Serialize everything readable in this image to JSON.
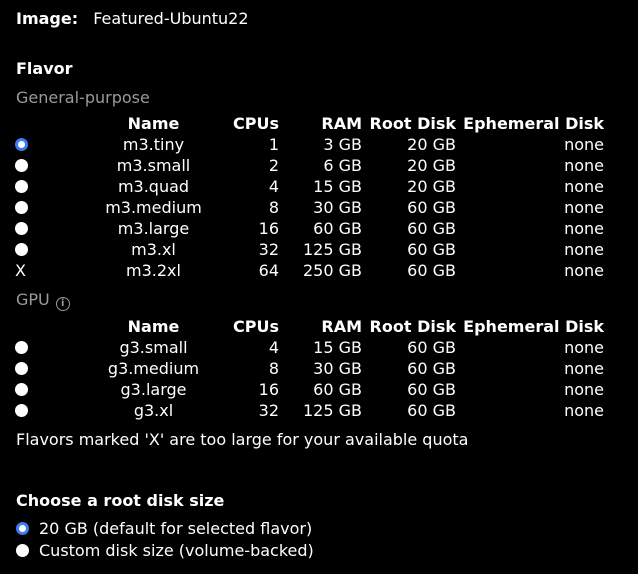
{
  "image": {
    "label": "Image:",
    "value": "Featured-Ubuntu22"
  },
  "flavor": {
    "heading": "Flavor",
    "columns": [
      "Name",
      "CPUs",
      "RAM",
      "Root Disk",
      "Ephemeral Disk"
    ],
    "general": {
      "label": "General-purpose",
      "rows": [
        {
          "selector": "radio-selected",
          "name": "m3.tiny",
          "cpus": "1",
          "ram": "3 GB",
          "root": "20 GB",
          "eph": "none"
        },
        {
          "selector": "radio",
          "name": "m3.small",
          "cpus": "2",
          "ram": "6 GB",
          "root": "20 GB",
          "eph": "none"
        },
        {
          "selector": "radio",
          "name": "m3.quad",
          "cpus": "4",
          "ram": "15 GB",
          "root": "20 GB",
          "eph": "none"
        },
        {
          "selector": "radio",
          "name": "m3.medium",
          "cpus": "8",
          "ram": "30 GB",
          "root": "60 GB",
          "eph": "none"
        },
        {
          "selector": "radio",
          "name": "m3.large",
          "cpus": "16",
          "ram": "60 GB",
          "root": "60 GB",
          "eph": "none"
        },
        {
          "selector": "radio",
          "name": "m3.xl",
          "cpus": "32",
          "ram": "125 GB",
          "root": "60 GB",
          "eph": "none"
        },
        {
          "selector": "X",
          "name": "m3.2xl",
          "cpus": "64",
          "ram": "250 GB",
          "root": "60 GB",
          "eph": "none"
        }
      ]
    },
    "gpu": {
      "label": "GPU",
      "info_icon": "info-circle-icon",
      "rows": [
        {
          "selector": "radio",
          "name": "g3.small",
          "cpus": "4",
          "ram": "15 GB",
          "root": "60 GB",
          "eph": "none"
        },
        {
          "selector": "radio",
          "name": "g3.medium",
          "cpus": "8",
          "ram": "30 GB",
          "root": "60 GB",
          "eph": "none"
        },
        {
          "selector": "radio",
          "name": "g3.large",
          "cpus": "16",
          "ram": "60 GB",
          "root": "60 GB",
          "eph": "none"
        },
        {
          "selector": "radio",
          "name": "g3.xl",
          "cpus": "32",
          "ram": "125 GB",
          "root": "60 GB",
          "eph": "none"
        }
      ]
    },
    "note": "Flavors marked 'X' are too large for your available quota"
  },
  "root_disk": {
    "heading": "Choose a root disk size",
    "options": [
      {
        "label": "20 GB (default for selected flavor)",
        "selected": true
      },
      {
        "label": "Custom disk size (volume-backed)",
        "selected": false
      }
    ]
  },
  "colors": {
    "background": "#000000",
    "text": "#ffffff",
    "muted": "#9a9a9a",
    "accent": "#3d7bf0"
  }
}
